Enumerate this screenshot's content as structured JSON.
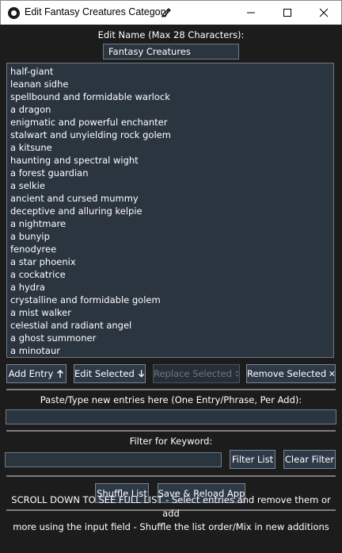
{
  "window": {
    "title": "Edit Fantasy Creatures Category",
    "title_icon": "pencil-icon",
    "controls": [
      "minimize-icon",
      "maximize-icon",
      "close-icon"
    ]
  },
  "edit_name": {
    "label": "Edit Name (Max 28 Characters):",
    "value": "Fantasy Creatures"
  },
  "entries": [
    "half-giant",
    "leanan sidhe",
    "spellbound and formidable warlock",
    "a dragon",
    "enigmatic and powerful enchanter",
    "stalwart and unyielding rock golem",
    "a kitsune",
    "haunting and spectral wight",
    "a forest guardian",
    "a selkie",
    "ancient and cursed mummy",
    "deceptive and alluring kelpie",
    "a nightmare",
    "a bunyip",
    "fenodyree",
    "a star phoenix",
    "a cockatrice",
    "a hydra",
    "crystalline and formidable golem",
    "a mist walker",
    "celestial and radiant angel",
    "a ghost summoner",
    "a minotaur"
  ],
  "actions": {
    "add": "Add Entry",
    "add_icon": "arrow-up-icon",
    "edit": "Edit Selected",
    "edit_icon": "arrow-down-icon",
    "replace": "Replace Selected",
    "replace_icon": "up-down-arrow-icon",
    "remove": "Remove Selected",
    "remove_icon": "x-icon"
  },
  "paste": {
    "label": "Paste/Type new entries here (One Entry/Phrase, Per Add):",
    "value": ""
  },
  "filter": {
    "label": "Filter for Keyword:",
    "value": "",
    "filter_button": "Filter List",
    "clear_button": "Clear Filter"
  },
  "bottom": {
    "shuffle": "Shuffle List",
    "save": "Save & Reload App"
  },
  "footer": {
    "line1": "SCROLL DOWN TO SEE FULL LIST - Select entries and remove them or add",
    "line2": "more using the input field - Shuffle the list order/Mix in new additions"
  },
  "colors": {
    "background": "#1c1c1c",
    "field": "#2b3540",
    "button": "#2d3946",
    "border": "#6f7a85",
    "titlebar": "#ffffff"
  }
}
